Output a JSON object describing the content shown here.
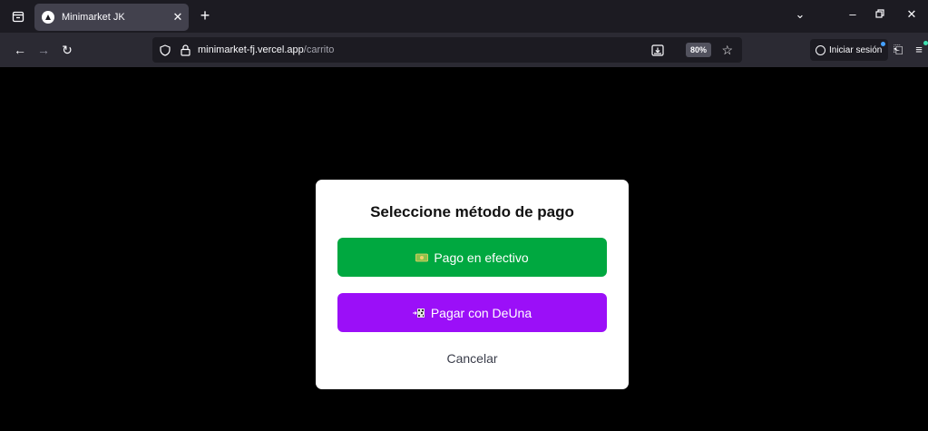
{
  "browser": {
    "tab_title": "Minimarket JK",
    "url_host": "minimarket-fj.vercel.app",
    "url_path": "/carrito",
    "zoom": "80%",
    "signin_label": "Iniciar sesión"
  },
  "modal": {
    "title": "Seleccione método de pago",
    "cash_label": "Pago en efectivo",
    "deuna_label": "Pagar con DeUna",
    "cancel_label": "Cancelar"
  },
  "colors": {
    "cash_button": "#00a840",
    "deuna_button": "#9b0ff8"
  },
  "icons": {
    "cash": "money-icon",
    "deuna": "qr-icon"
  }
}
